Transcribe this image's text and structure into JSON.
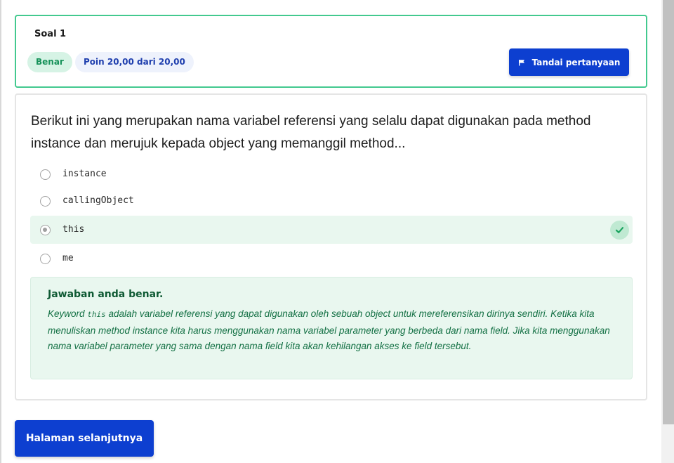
{
  "question": {
    "label": "Soal 1",
    "status_badge": "Benar",
    "points_badge": "Poin 20,00 dari 20,00",
    "flag_button_label": "Tandai pertanyaan",
    "text": "Berikut ini yang merupakan nama variabel referensi yang selalu dapat digunakan pada method instance dan merujuk kepada object yang memanggil method...",
    "options": [
      {
        "label": "instance",
        "selected": false
      },
      {
        "label": "callingObject",
        "selected": false
      },
      {
        "label": "this",
        "selected": true,
        "correct": true
      },
      {
        "label": "me",
        "selected": false
      }
    ]
  },
  "feedback": {
    "title": "Jawaban anda benar.",
    "body_before_code": "Keyword ",
    "code": "this",
    "body_after_code": " adalah variabel referensi yang dapat digunakan oleh sebuah object untuk mereferensikan dirinya sendiri. Ketika kita menuliskan method instance kita harus menggunakan nama variabel parameter yang berbeda dari nama field. Jika kita menggunakan nama variabel parameter yang sama dengan nama field kita akan kehilangan akses ke field tersebut."
  },
  "navigation": {
    "next_button_label": "Halaman selanjutnya"
  },
  "icons": {
    "flag": "flag-icon",
    "check": "check-icon"
  },
  "colors": {
    "primary": "#0d3fd0",
    "success_border": "#43c98f",
    "success_bg": "#e9f7ef",
    "success_text": "#137044"
  }
}
